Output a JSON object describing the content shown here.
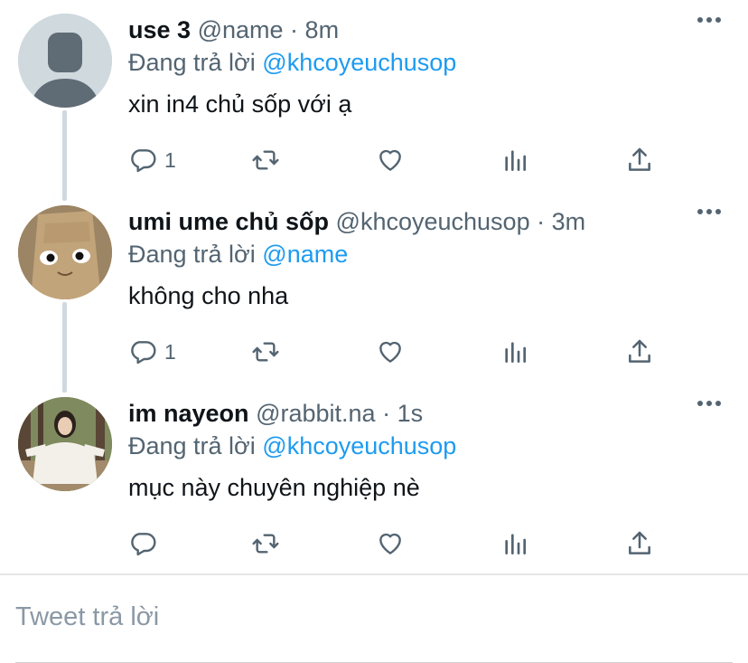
{
  "reply_label": "Đang trả lời",
  "tweets": [
    {
      "display_name": "use 3",
      "handle": "@name",
      "dot": "·",
      "time": "8m",
      "replying_to": "@khcoyeuchusop",
      "text": "xin in4 chủ sốp với ạ",
      "reply_count": "1"
    },
    {
      "display_name": "umi ume chủ sốp",
      "handle": "@khcoyeuchusop",
      "dot": "·",
      "time": "3m",
      "replying_to": "@name",
      "text": "không cho nha",
      "reply_count": "1"
    },
    {
      "display_name": "im nayeon",
      "handle": "@rabbit.na",
      "dot": "·",
      "time": "1s",
      "replying_to": "@khcoyeuchusop",
      "text": "mục này chuyên nghiệp nè",
      "reply_count": ""
    }
  ],
  "composer": {
    "placeholder": "Tweet trả lời"
  },
  "icons": [
    "reply-icon",
    "retweet-icon",
    "like-icon",
    "analytics-icon",
    "share-icon",
    "more-icon"
  ],
  "colors": {
    "mention": "#1d9bf0",
    "secondary": "#536471",
    "thread_line": "#cfd9de"
  }
}
